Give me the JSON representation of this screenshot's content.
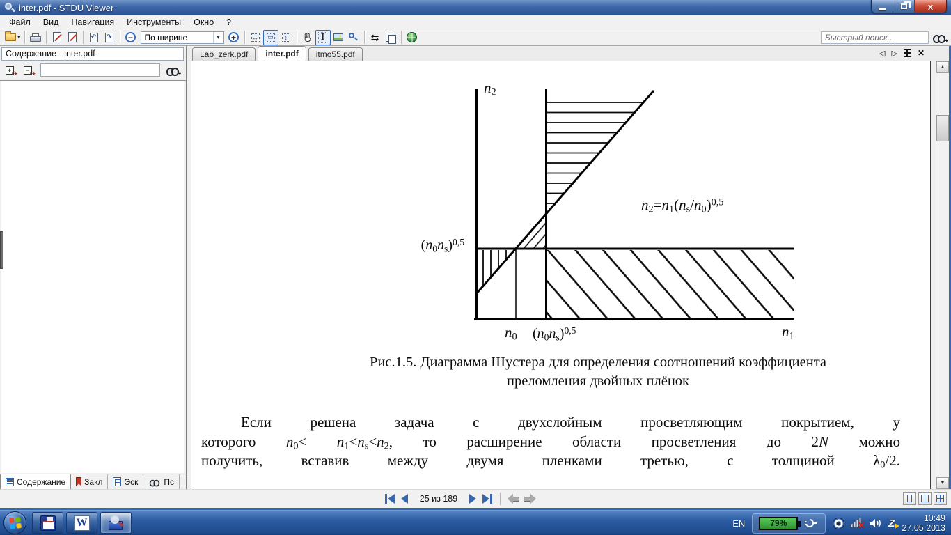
{
  "window": {
    "title": "inter.pdf - STDU Viewer",
    "controls": {
      "minimize": "",
      "restore": "",
      "close_label": "x"
    }
  },
  "menu": {
    "items": [
      {
        "html": "<u>Ф</u>айл"
      },
      {
        "html": "<u>В</u>ид"
      },
      {
        "html": "<u>Н</u>авигация"
      },
      {
        "html": "<u>И</u>нструменты"
      },
      {
        "html": "<u>О</u>кно"
      },
      {
        "html": "?"
      }
    ]
  },
  "toolbar": {
    "zoom_mode": "По ширине",
    "search_placeholder": "Быстрый поиск...",
    "glyphs": {
      "dropdown": "▾",
      "combo_drop": "▾",
      "zoom_out": "−",
      "zoom_in": "+",
      "rotate_left": "↶",
      "rotate_right": "↷",
      "fit_width": "↔",
      "fit_page": "▭",
      "fit_height": "↕",
      "swap": "⇆",
      "search_arrow": "➜"
    },
    "icon_names": [
      "open-folder-icon",
      "print-icon",
      "export-page-icon",
      "export-text-icon",
      "rotate-left-icon",
      "rotate-right-icon",
      "zoom-out-icon",
      "zoom-combobox",
      "zoom-in-icon",
      "fit-width-icon",
      "fit-page-icon",
      "fit-height-icon",
      "hand-tool-icon",
      "text-select-icon",
      "image-select-icon",
      "zoom-region-icon",
      "swap-icon",
      "copy-icon",
      "globe-icon",
      "binoculars-icon"
    ]
  },
  "sidebar": {
    "header": "Содержание - inter.pdf",
    "search_value": "",
    "expand_glyph": "+",
    "collapse_glyph": "−",
    "curve_glyph": "↷",
    "tabs": [
      {
        "label": "Содержание",
        "active": true
      },
      {
        "label": "Закл",
        "active": false
      },
      {
        "label": "Эск",
        "active": false
      },
      {
        "label": "Пс",
        "active": false
      }
    ]
  },
  "doc_tabs": {
    "tabs": [
      {
        "label": "Lab_zerk.pdf",
        "active": false
      },
      {
        "label": "inter.pdf",
        "active": true
      },
      {
        "label": "itmo55.pdf",
        "active": false
      }
    ],
    "prev_glyph": "◁",
    "next_glyph": "▷"
  },
  "scrollbar": {
    "up_glyph": "▲",
    "down_glyph": "▼"
  },
  "document": {
    "figure": {
      "y_axis_label_html": "<i>n</i><sub>2</sub>",
      "x_axis_label_html": "<i>n</i><sub>1</sub>",
      "left_label_html": "(<i>n</i><sub>0</sub><i>n</i><sub>s</sub>)<sup>0,5</sup>",
      "x_tick1_html": "<i>n</i><sub>0</sub>",
      "x_tick2_html": "(<i>n</i><sub>0</sub><i>n</i><sub>s</sub>)<sup>0,5</sup>",
      "formula_html": "<i>n</i><sub>2</sub>=<i>n</i><sub>1</sub>(<i>n</i><sub>s</sub>/<i>n</i><sub>0</sub>)<sup>0,5</sup>"
    },
    "caption_line1": "Рис.1.5. Диаграмма Шустера для определения соотношений коэффициента",
    "caption_line2": "преломления двойных плёнок",
    "para_line1": "Если решена задача с двухслойным просветляющим покрытием, у",
    "para_line2_html": "которого <i>n</i><sub>0</sub>&lt; <i>n</i><sub>1</sub>&lt;<i>n</i><sub>s</sub>&lt;<i>n</i><sub>2</sub>, то расширение области просветления до 2<i>N</i> можно",
    "para_line3_html": "получить, вставив между двумя пленками третью, с толщиной λ<sub>0</sub>/2."
  },
  "statusbar": {
    "page_info": "25 из 189"
  },
  "taskbar": {
    "tray": {
      "lang": "EN",
      "battery_percent": "79%",
      "time": "10:49",
      "date": "27.05.2013"
    }
  },
  "colors": {
    "titlebar_blue": "#3c66a6",
    "taskbar_blue": "#2c5ca2",
    "selection_border": "#316ac5",
    "battery_green": "#3fae3f",
    "close_red": "#cc4f39",
    "flag_red": "#e64a34",
    "flag_green": "#7db700",
    "flag_blue": "#0faaf0",
    "flag_yellow": "#ffc40d"
  }
}
